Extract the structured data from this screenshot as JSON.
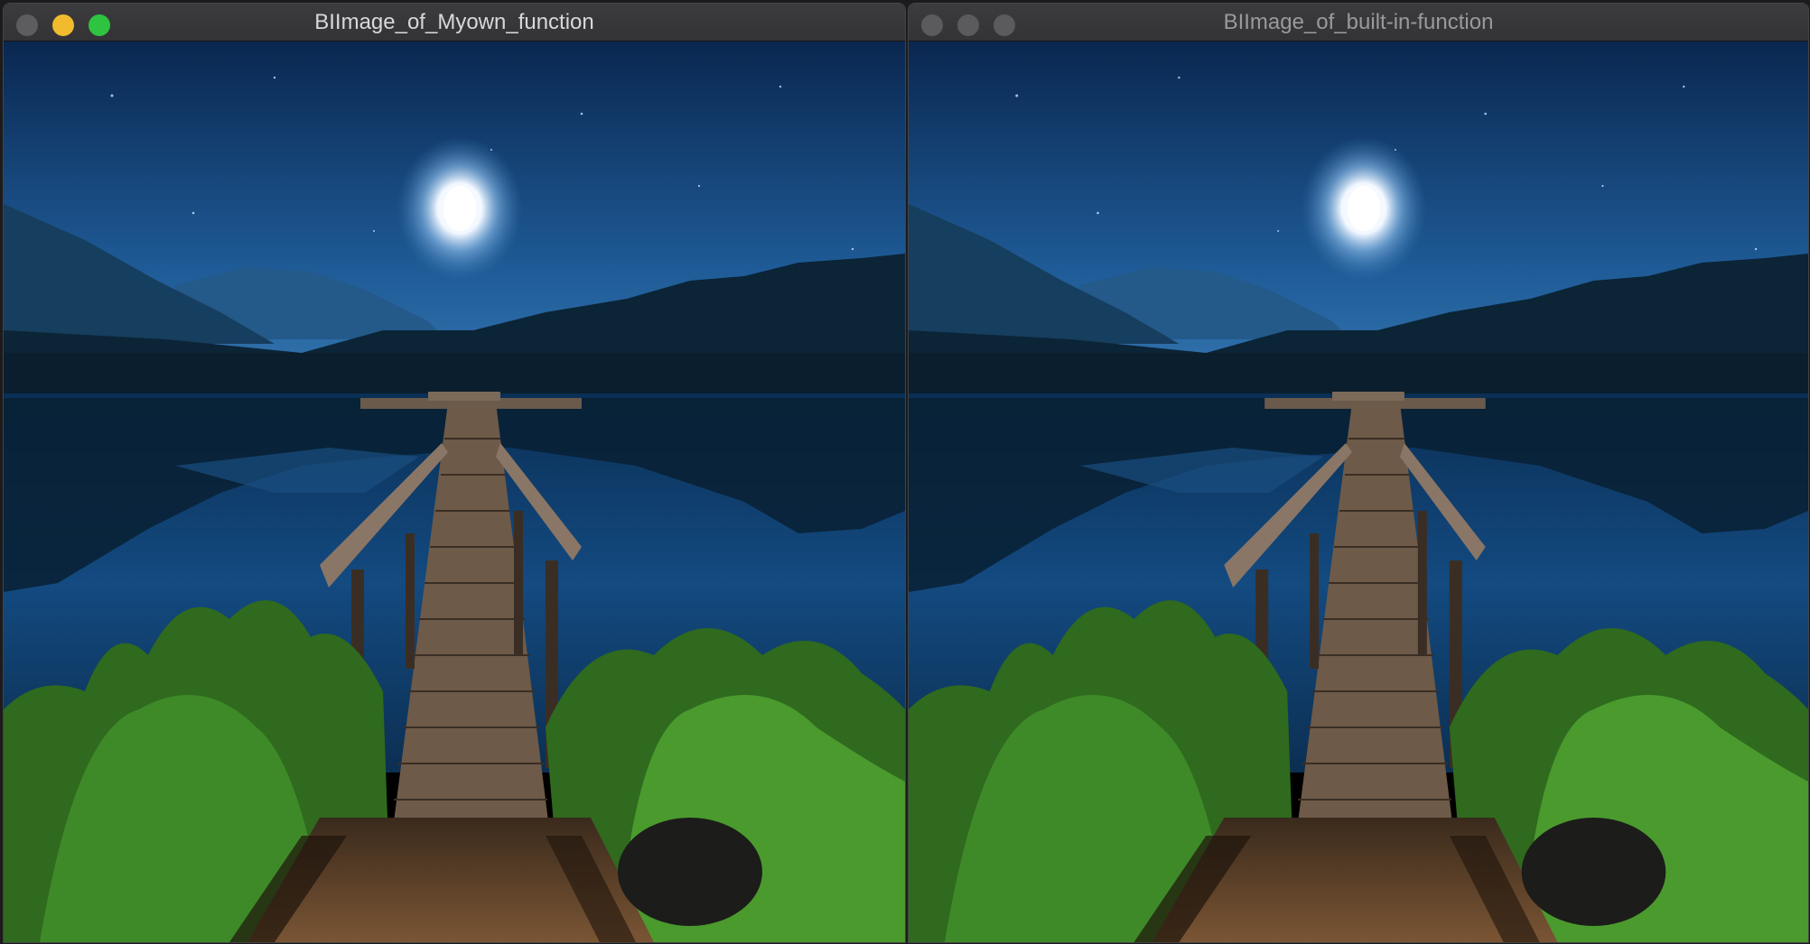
{
  "windows": [
    {
      "title": "BIImage_of_Myown_function",
      "active": true,
      "controls": [
        "close-icon",
        "minimize-icon",
        "maximize-icon"
      ]
    },
    {
      "title": "BIImage_of_built-in-function",
      "active": false,
      "controls": [
        "close-icon",
        "minimize-icon",
        "maximize-icon"
      ]
    }
  ],
  "colors": {
    "sky_top": "#0b2a52",
    "sky_bottom": "#2a6aa8",
    "water": "#0f3d6d",
    "grass": "#3f8a28",
    "dirt": "#6b4a2e",
    "dock": "#6e5a48"
  }
}
